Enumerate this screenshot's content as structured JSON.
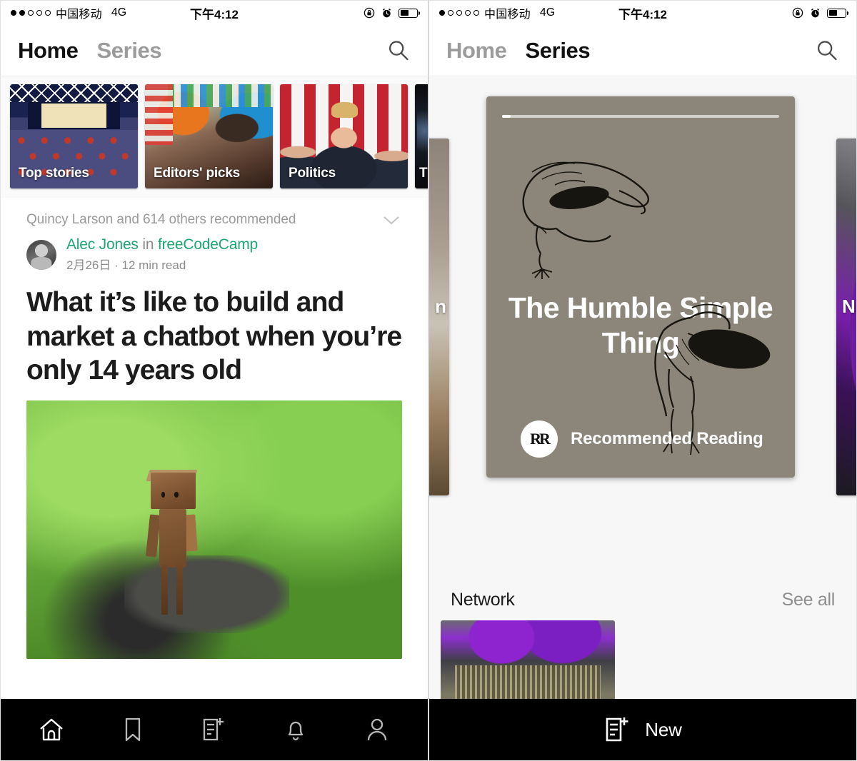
{
  "left_phone": {
    "status_bar": {
      "signal_dots_total": 5,
      "signal_dots_filled": 2,
      "carrier": "中国移动",
      "network": "4G",
      "time": "下午4:12",
      "icons": [
        "rotation-lock-icon",
        "alarm-clock-icon",
        "battery-icon"
      ],
      "battery_percent": 52
    },
    "nav": {
      "tab_home": "Home",
      "tab_series": "Series",
      "active_tab": "Home",
      "search_icon": "search-icon"
    },
    "categories": [
      {
        "label": "Top stories",
        "image": "convention-hall-photo"
      },
      {
        "label": "Editors' picks",
        "image": "crowd-with-flags-photo"
      },
      {
        "label": "Politics",
        "image": "trump-speech-photo"
      },
      {
        "label": "T",
        "image": "dark-photo"
      }
    ],
    "feed": {
      "recommendation": "Quincy Larson and 614 others recommended",
      "expand_icon": "chevron-down-icon",
      "author": "Alec Jones",
      "in_word": "in",
      "publication": "freeCodeCamp",
      "date": "2月26日",
      "separator": "·",
      "read_time": "12 min read",
      "headline": "What it’s like to build and market a chatbot when you’re only 14 years old",
      "hero_image": "wooden-toy-robot-on-grass"
    },
    "tabbar": [
      {
        "name": "home-icon",
        "label": "Home",
        "active": true
      },
      {
        "name": "bookmark-icon",
        "label": "Bookmarks",
        "active": false
      },
      {
        "name": "new-story-icon",
        "label": "New story",
        "active": false
      },
      {
        "name": "bell-icon",
        "label": "Notifications",
        "active": false
      },
      {
        "name": "profile-icon",
        "label": "Profile",
        "active": false
      }
    ]
  },
  "right_phone": {
    "status_bar": {
      "signal_dots_total": 5,
      "signal_dots_filled": 1,
      "carrier": "中国移动",
      "network": "4G",
      "time": "下午4:12",
      "battery_percent": 52
    },
    "nav": {
      "tab_home": "Home",
      "tab_series": "Series",
      "active_tab": "Series",
      "search_icon": "search-icon"
    },
    "featured_card": {
      "title": "The Humble Simple Thing",
      "logo_text": "RR",
      "footer_label": "Recommended Reading",
      "progress_percent": 3,
      "background_color": "#8b8679",
      "illustration": "bird-line-drawings"
    },
    "side_cards": [
      {
        "position": "left",
        "image": "child-photo",
        "label_fragment": "n"
      },
      {
        "position": "right",
        "image": "purple-cables-photo",
        "label_fragment": "N\na"
      }
    ],
    "network_section": {
      "title": "Network",
      "see_all": "See all",
      "thumbnail": "server-rack-purple-cables"
    },
    "bottom_bar": {
      "new_label": "New",
      "new_icon": "new-story-icon"
    }
  },
  "colors": {
    "brand_green": "#1ca672",
    "active_text": "#121212",
    "inactive_text": "#9b9b9b",
    "muted_text": "#8c8c8c",
    "tabbar_bg": "#000000",
    "card_bg": "#8b8679"
  }
}
